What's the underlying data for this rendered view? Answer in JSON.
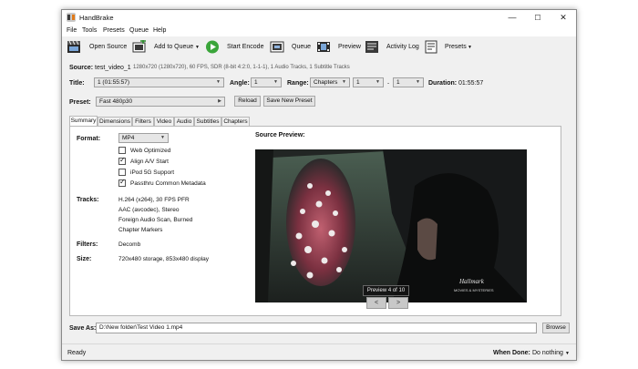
{
  "app": {
    "title": "HandBrake"
  },
  "window_controls": {
    "minimize": "—",
    "maximize": "☐",
    "close": "✕"
  },
  "menu": [
    "File",
    "Tools",
    "Presets",
    "Queue",
    "Help"
  ],
  "toolbar": {
    "open_source": "Open Source",
    "add_to_queue": "Add to Queue",
    "start_encode": "Start Encode",
    "queue": "Queue",
    "preview": "Preview",
    "activity_log": "Activity Log",
    "presets": "Presets"
  },
  "source": {
    "label": "Source:",
    "name": "test_video_1",
    "info": "1280x720 (1280x720), 60 FPS, SDR (8-bit 4:2:0, 1-1-1), 1 Audio Tracks, 1 Subtitle Tracks"
  },
  "title_row": {
    "title_label": "Title:",
    "title_value": "1 (01:55:57)",
    "angle_label": "Angle:",
    "angle_value": "1",
    "range_label": "Range:",
    "range_value": "Chapters",
    "range_from": "1",
    "range_sep": "-",
    "range_to": "1",
    "duration_label": "Duration:",
    "duration_value": "01:55:57"
  },
  "preset_row": {
    "label": "Preset:",
    "value": "Fast 480p30",
    "reload": "Reload",
    "save_new": "Save New Preset"
  },
  "tabs": [
    "Summary",
    "Dimensions",
    "Filters",
    "Video",
    "Audio",
    "Subtitles",
    "Chapters"
  ],
  "summary": {
    "format_label": "Format:",
    "format_value": "MP4",
    "options": [
      {
        "label": "Web Optimized",
        "checked": false
      },
      {
        "label": "Align A/V Start",
        "checked": true
      },
      {
        "label": "iPod 5G Support",
        "checked": false
      },
      {
        "label": "Passthru Common Metadata",
        "checked": true
      }
    ],
    "tracks_label": "Tracks:",
    "tracks": [
      "H.264 (x264), 30 FPS PFR",
      "AAC (avcodec), Stereo",
      "Foreign Audio Scan, Burned",
      "Chapter Markers"
    ],
    "filters_label": "Filters:",
    "filters_value": "Decomb",
    "size_label": "Size:",
    "size_value": "720x480 storage, 853x480 display",
    "preview_label": "Source Preview:",
    "preview_counter": "Preview 4 of 10",
    "watermark_line1": "Hallmark",
    "watermark_line2": "MOVIES & MYSTERIES",
    "prev_btn": "<",
    "next_btn": ">"
  },
  "save_as": {
    "label": "Save As:",
    "value": "D:\\New folder\\Test Video 1.mp4",
    "browse": "Browse"
  },
  "status": {
    "text": "Ready",
    "when_done_label": "When Done:",
    "when_done_value": "Do nothing"
  }
}
